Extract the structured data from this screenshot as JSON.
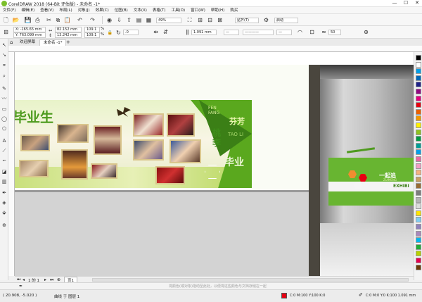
{
  "app": {
    "title": "CorelDRAW 2018 (64-Bit 评估版) - 未命名 -1*",
    "min": "—",
    "max": "☐",
    "close": "✕"
  },
  "menu": [
    "文件(F)",
    "编辑(E)",
    "查看(V)",
    "布局(L)",
    "对象(J)",
    "效果(C)",
    "位图(B)",
    "文本(X)",
    "表格(T)",
    "工具(O)",
    "窗口(W)",
    "帮助(H)",
    "购买"
  ],
  "toolbar": {
    "zoom": "49%",
    "snap": "贴齐(T)",
    "launch": "启动"
  },
  "props": {
    "x": "X: -165.65 mm",
    "y": "Y: 763.099 mm",
    "w": "82.152 mm",
    "h": "13.242 mm",
    "sx": "109.1",
    "sy": "109.1",
    "pct": "%",
    "rot": ".0",
    "outline": "1.091 mm",
    "smooth": "50"
  },
  "tabs": {
    "welcome": "欢迎屏幕",
    "doc": "未命名 -1*"
  },
  "design": {
    "title": "毕业生",
    "side_en": "FEN FANG",
    "side_cn": "芬芳",
    "vert_en": "TAO LI",
    "vert_cn": "桃李",
    "corner_cn": "毕业",
    "wall_title": "一起追",
    "wall_sub": "ZUIMENG",
    "exhibit": "EXHIBI"
  },
  "pages": {
    "counter": "1 的 1",
    "page": "页1"
  },
  "status": {
    "coords": "( 20.908, -5.020 )",
    "hint": "将颜色(或对象)拖动至此处，以便将这些颜色与文档存储在一起",
    "layer": "曲线 于 图层 1",
    "fill_label": "C:0 M:100 Y:100 K:0",
    "outline_label": "C:0 M:0 Y:0 K:100 1.091 mm"
  },
  "palette": [
    "#000000",
    "#ffffff",
    "#00a0e9",
    "#0068b7",
    "#1d2088",
    "#920783",
    "#e4007f",
    "#e60012",
    "#eb6100",
    "#f39800",
    "#fff100",
    "#8fc31f",
    "#009944",
    "#009e96",
    "#00a0e9",
    "#ea68a2",
    "#f19ec2",
    "#f6b37f",
    "#c9a063",
    "#996c33",
    "#7d7d7d",
    "#b5b5b5",
    "#dcdcdc",
    "#ffe600",
    "#7ecef4",
    "#8f82bc",
    "#aa89bd",
    "#00b7ee",
    "#22ac38",
    "#b8d200",
    "#e5004f",
    "#6a3906"
  ],
  "colors": {
    "green": "#5aa81e",
    "dark_green": "#3b7f16",
    "photo_frame": "#d9c58c",
    "wall_green": "#68b531",
    "accent_red": "#e60012"
  }
}
